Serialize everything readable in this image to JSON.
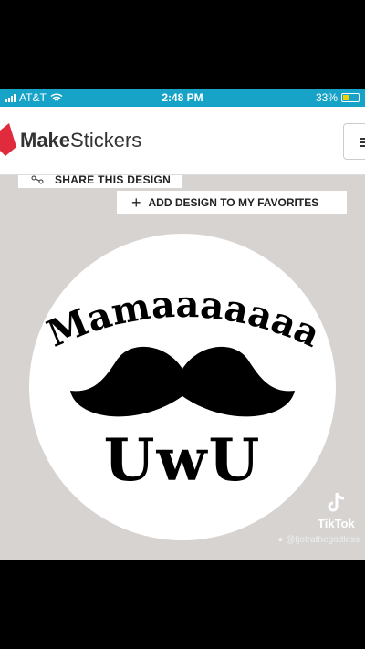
{
  "status_bar": {
    "carrier": "AT&T",
    "time": "2:48 PM",
    "battery": "33%"
  },
  "header": {
    "brand_part1": "Make",
    "brand_part2": "Stickers"
  },
  "actions": {
    "share_label": "SHARE THIS DESIGN",
    "favorites_label": "ADD DESIGN TO MY FAVORITES"
  },
  "sticker": {
    "top_text": "Mamaaaaaaa",
    "bottom_text": "UwU"
  },
  "watermark": {
    "app": "TikTok",
    "user": "@fjotrathegodless"
  }
}
